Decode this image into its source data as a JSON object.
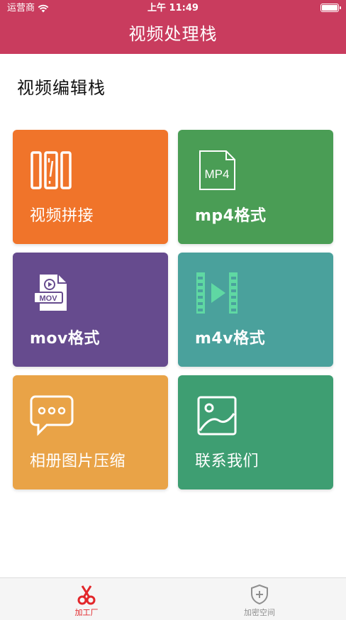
{
  "status_bar": {
    "carrier": "运营商",
    "time": "上午 11:49"
  },
  "header": {
    "title": "视频处理栈"
  },
  "section": {
    "title": "视频编辑栈"
  },
  "tiles": [
    {
      "label": "视频拼接",
      "icon": "film-strip-icon",
      "color": "#f0742a"
    },
    {
      "label": "mp4格式",
      "icon": "mp4-file-icon",
      "color": "#4a9d55"
    },
    {
      "label": "mov格式",
      "icon": "mov-file-icon",
      "color": "#664b8e"
    },
    {
      "label": "m4v格式",
      "icon": "video-play-icon",
      "color": "#4aa19c"
    },
    {
      "label": "相册图片压缩",
      "icon": "chat-bubble-icon",
      "color": "#e9a347"
    },
    {
      "label": "联系我们",
      "icon": "image-icon",
      "color": "#3e9e72"
    }
  ],
  "mp4_icon_text": "MP4",
  "mov_icon_text": "MOV",
  "tabbar": {
    "active_color": "#e2262a",
    "inactive_color": "#8f8f8f",
    "tabs": [
      {
        "label": "加工厂",
        "icon": "scissors-icon",
        "active": true
      },
      {
        "label": "加密空间",
        "icon": "shield-plus-icon",
        "active": false
      }
    ]
  }
}
